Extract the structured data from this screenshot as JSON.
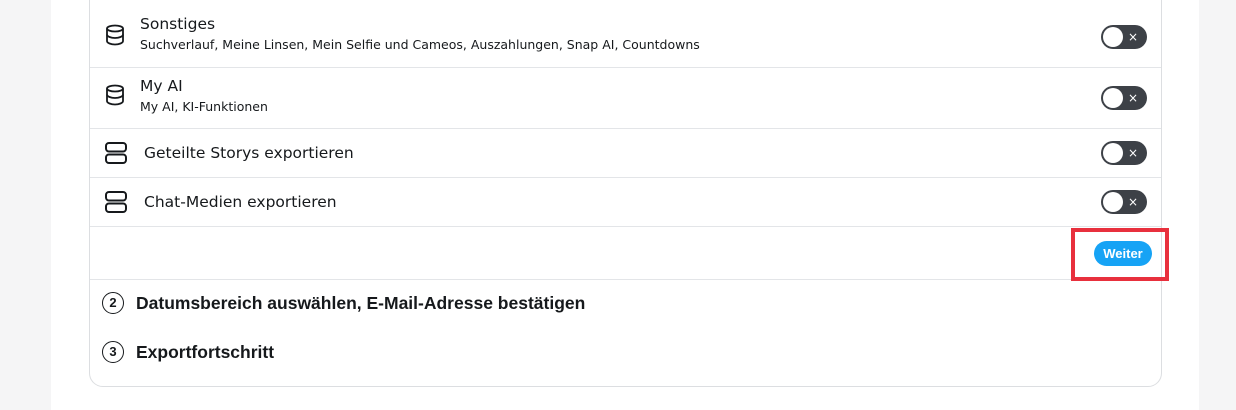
{
  "export_options": [
    {
      "title": "Sonstiges",
      "subtitle": "Suchverlauf, Meine Linsen, Mein Selfie und Cameos, Auszahlungen, Snap AI, Countdowns",
      "icon": "database-icon",
      "toggle_state": "off",
      "toggle_symbol": "×"
    },
    {
      "title": "My AI",
      "subtitle": "My AI, KI-Funktionen",
      "icon": "database-icon",
      "toggle_state": "off",
      "toggle_symbol": "×"
    },
    {
      "title": "Geteilte Storys exportieren",
      "icon": "server-icon",
      "toggle_state": "off",
      "toggle_symbol": "×"
    },
    {
      "title": "Chat-Medien exportieren",
      "icon": "server-icon",
      "toggle_state": "off",
      "toggle_symbol": "×"
    }
  ],
  "actions": {
    "next_label": "Weiter"
  },
  "steps": [
    {
      "number": "2",
      "title": "Datumsbereich auswählen, E-Mail-Adresse bestätigen"
    },
    {
      "number": "3",
      "title": "Exportfortschritt"
    }
  ],
  "colors": {
    "accent": "#16a3f5",
    "highlight": "#e8303d",
    "toggle_off": "#3d4147"
  }
}
